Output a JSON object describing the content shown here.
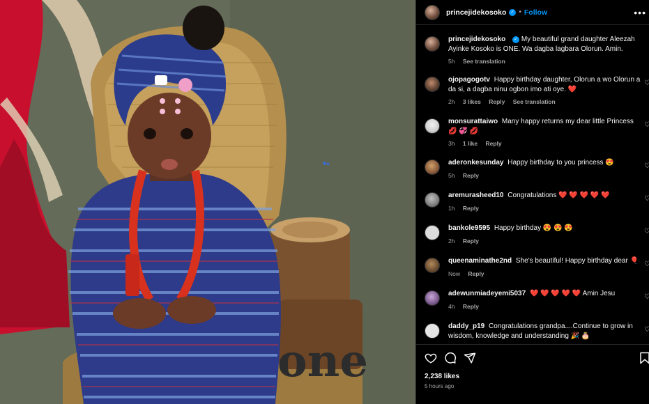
{
  "post": {
    "author": "princejidekosoko",
    "follow_label": "Follow",
    "caption": "My beautiful grand daughter Aleezah Ayinke Kosoko is ONE. Wa dagba lagbara Olorun. Amin.",
    "caption_time": "5h",
    "see_translation": "See translation",
    "likes": "2,238 likes",
    "posted": "5 hours ago",
    "photo_sign": "one",
    "colors": {
      "accent": "#0095f6",
      "heart": "#ed1c24",
      "background": "#000000"
    }
  },
  "comments": [
    {
      "user": "ojopagogotv",
      "text": "Happy birthday daughter, Olorun a wo Olorun a da si, a dagba ninu ogbon imo ati oye.",
      "emoji": "❤️",
      "time": "2h",
      "likes": "3 likes",
      "reply": "Reply",
      "translation": "See translation"
    },
    {
      "user": "monsurattaiwo",
      "text": "Many happy returns my dear little Princess",
      "emoji": "💋 💞 💋",
      "time": "3h",
      "likes": "1 like",
      "reply": "Reply"
    },
    {
      "user": "aderonkesunday",
      "text": "Happy birthday to you princess",
      "emoji": "😍",
      "time": "5h",
      "reply": "Reply"
    },
    {
      "user": "aremurasheed10",
      "text": "Congratulations",
      "emoji": "❤️ ❤️ ❤️ ❤️ ❤️",
      "time": "1h",
      "reply": "Reply"
    },
    {
      "user": "bankole9595",
      "text": "Happy birthday",
      "emoji": "😍 😍 😍",
      "time": "2h",
      "reply": "Reply"
    },
    {
      "user": "queenaminathe2nd",
      "text": "She's beautiful! Happy birthday dear",
      "emoji": "🎈",
      "time": "Now",
      "reply": "Reply"
    },
    {
      "user": "adewunmiadeyemi5037",
      "emoji": "❤️ ❤️ ❤️ ❤️ ❤️",
      "text": "Amin Jesu",
      "time": "4h",
      "reply": "Reply"
    },
    {
      "user": "daddy_p19",
      "text": "Congratulations grandpa....Continue to grow in wisdom, knowledge and understanding",
      "emoji": "🎉 🎂",
      "time": "",
      "reply": ""
    }
  ],
  "icons": [
    "heart-icon",
    "comment-icon",
    "share-icon",
    "bookmark-icon",
    "more-options-icon",
    "verified-badge-icon"
  ]
}
